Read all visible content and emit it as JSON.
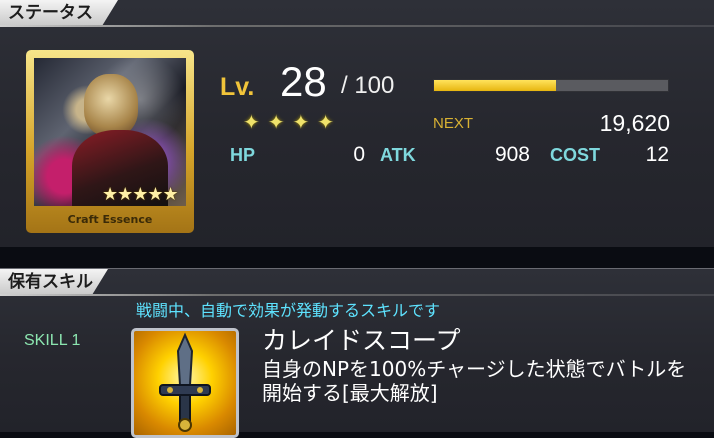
{
  "status": {
    "tab_label": "ステータス",
    "card": {
      "stars": "★★★★★",
      "label": "Craft Essence",
      "rarity": 5
    },
    "level": {
      "label": "Lv.",
      "value": "28",
      "max": "/ 100",
      "exp_fraction": 0.52
    },
    "limit_break_stars": "✦✦✦✦",
    "next": {
      "label": "NEXT",
      "value": "19,620"
    },
    "stats": {
      "hp_label": "HP",
      "hp": "0",
      "atk_label": "ATK",
      "atk": "908",
      "cost_label": "COST",
      "cost": "12"
    }
  },
  "skills": {
    "tab_label": "保有スキル",
    "description": "戦闘中、自動で効果が発動するスキルです",
    "skill_1": {
      "slot_label": "SKILL 1",
      "name": "カレイドスコープ",
      "effect": "自身のNPを100%チャージした状態でバトルを開始する[最大解放]",
      "icon": "sword-icon"
    }
  },
  "colors": {
    "accent_gold": "#f1c43a",
    "stat_label": "#7fd8dd",
    "skill_info": "#5ee3ff",
    "exp_fill": "#e7b60f"
  }
}
